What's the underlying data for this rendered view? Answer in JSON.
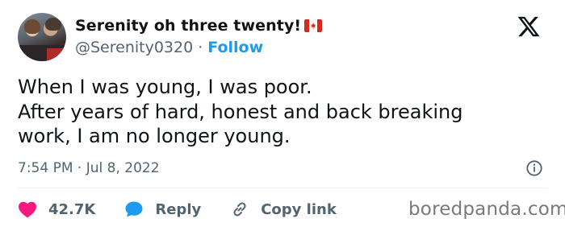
{
  "author": {
    "display_name": "Serenity oh three twenty!",
    "handle": "@Serenity0320",
    "separator": "·",
    "follow_label": "Follow",
    "flag_icon": "canada-flag-icon"
  },
  "tweet": {
    "lines": [
      "When I was young, I was poor.",
      "After years of hard, honest and back breaking",
      "work, I am no longer young."
    ],
    "timestamp": "7:54 PM · Jul 8, 2022"
  },
  "actions": {
    "likes": "42.7K",
    "reply_label": "Reply",
    "copy_link_label": "Copy link"
  },
  "watermark": "boredpanda.com",
  "colors": {
    "accent": "#1d9bf0",
    "like": "#f91880",
    "text": "#0f1419",
    "secondary": "#536471"
  }
}
